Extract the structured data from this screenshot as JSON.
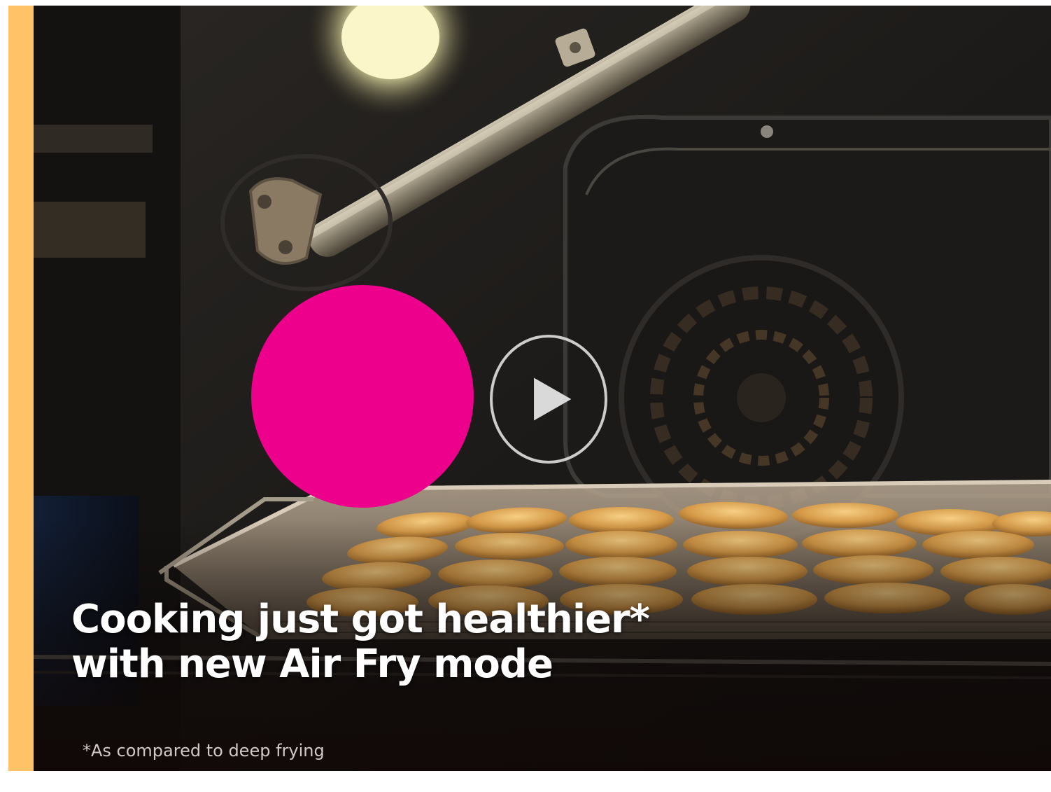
{
  "video": {
    "headline_line1": "Cooking just got healthier*",
    "headline_line2": "with new Air Fry mode",
    "disclaimer": "*As compared to deep frying",
    "play_icon": "play-icon"
  },
  "colors": {
    "accent_bar": "#ffc266",
    "marker": "#ec008c",
    "headline_text": "#ffffff"
  }
}
